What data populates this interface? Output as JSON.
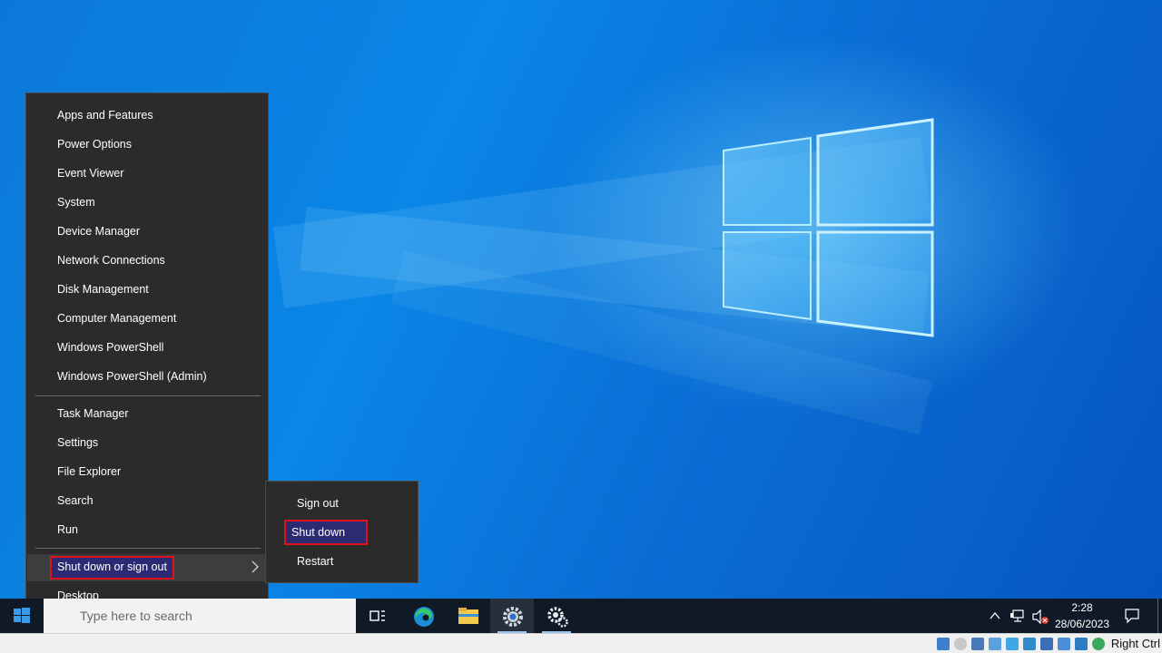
{
  "context_menu": {
    "items_group1": [
      "Apps and Features",
      "Power Options",
      "Event Viewer",
      "System",
      "Device Manager",
      "Network Connections",
      "Disk Management",
      "Computer Management",
      "Windows PowerShell",
      "Windows PowerShell (Admin)"
    ],
    "items_group2": [
      "Task Manager",
      "Settings",
      "File Explorer",
      "Search",
      "Run"
    ],
    "shutdown_item": "Shut down or sign out",
    "desktop_item": "Desktop"
  },
  "submenu": {
    "sign_out": "Sign out",
    "shut_down": "Shut down",
    "restart": "Restart"
  },
  "taskbar": {
    "search_placeholder": "Type here to search",
    "pinned": [
      "task-view-icon",
      "edge-icon",
      "file-explorer-icon",
      "settings-icon",
      "settings-alt-icon"
    ],
    "clock_time": "2:28",
    "clock_date": "28/06/2023"
  },
  "vm_statusbar": {
    "host_key": "Right Ctrl"
  },
  "colors": {
    "menu_bg": "#2b2b2b",
    "highlight_border": "#e0121b",
    "highlight_fill": "#2c2a72",
    "taskbar_bg": "#101a27"
  }
}
